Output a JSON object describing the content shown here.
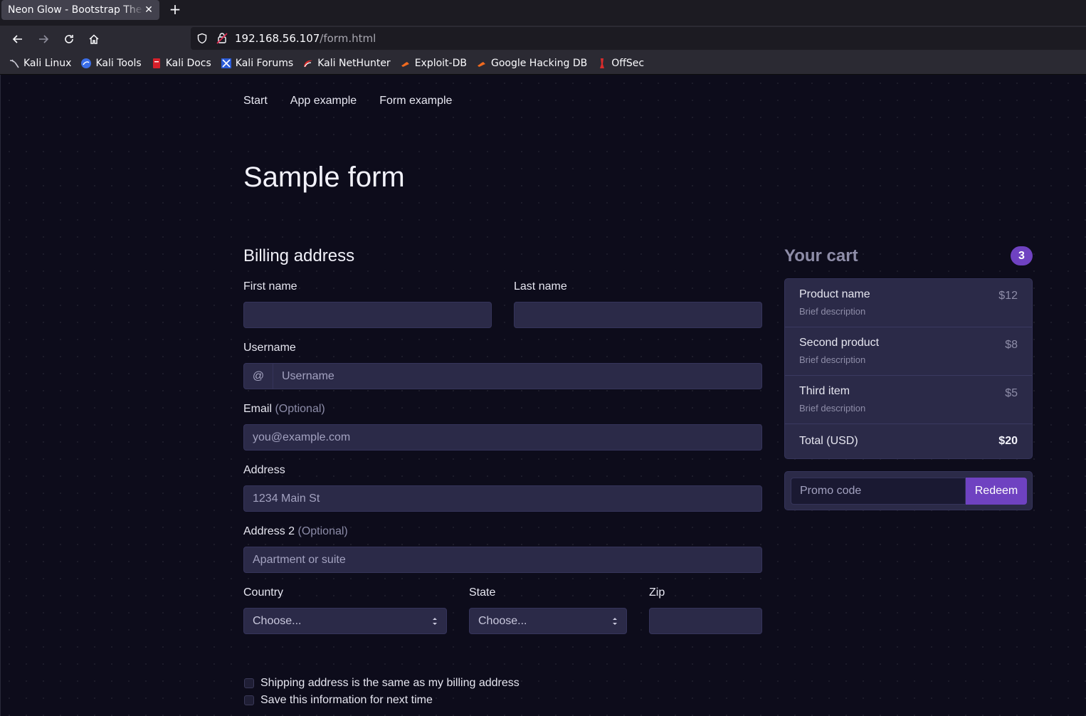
{
  "browser": {
    "tab_title": "Neon Glow - Bootstrap Theme",
    "url_host": "192.168.56.107",
    "url_path": "/form.html",
    "bookmarks": [
      {
        "label": "Kali Linux",
        "icon": "kali-dragon-icon"
      },
      {
        "label": "Kali Tools",
        "icon": "kali-tools-icon"
      },
      {
        "label": "Kali Docs",
        "icon": "kali-docs-icon"
      },
      {
        "label": "Kali Forums",
        "icon": "kali-forums-icon"
      },
      {
        "label": "Kali NetHunter",
        "icon": "nethunter-icon"
      },
      {
        "label": "Exploit-DB",
        "icon": "exploit-db-icon"
      },
      {
        "label": "Google Hacking DB",
        "icon": "ghdb-icon"
      },
      {
        "label": "OffSec",
        "icon": "offsec-icon"
      }
    ]
  },
  "site_nav": [
    "Start",
    "App example",
    "Form example"
  ],
  "page_title": "Sample form",
  "billing": {
    "title": "Billing address",
    "first_name_label": "First name",
    "last_name_label": "Last name",
    "username_label": "Username",
    "username_prefix": "@",
    "username_placeholder": "Username",
    "email_label": "Email",
    "email_optional": "(Optional)",
    "email_placeholder": "you@example.com",
    "address_label": "Address",
    "address_placeholder": "1234 Main St",
    "address2_label": "Address 2",
    "address2_optional": "(Optional)",
    "address2_placeholder": "Apartment or suite",
    "country_label": "Country",
    "country_value": "Choose...",
    "state_label": "State",
    "state_value": "Choose...",
    "zip_label": "Zip",
    "same_address_label": "Shipping address is the same as my billing address",
    "save_info_label": "Save this information for next time"
  },
  "cart": {
    "title": "Your cart",
    "count": "3",
    "items": [
      {
        "name": "Product name",
        "description": "Brief description",
        "price": "$12"
      },
      {
        "name": "Second product",
        "description": "Brief description",
        "price": "$8"
      },
      {
        "name": "Third item",
        "description": "Brief description",
        "price": "$5"
      }
    ],
    "total_label": "Total (USD)",
    "total_value": "$20",
    "promo_placeholder": "Promo code",
    "redeem_label": "Redeem"
  },
  "colors": {
    "accent": "#6f42c1",
    "page_bg": "#0d0c1b",
    "field_bg": "#2b2a48"
  }
}
